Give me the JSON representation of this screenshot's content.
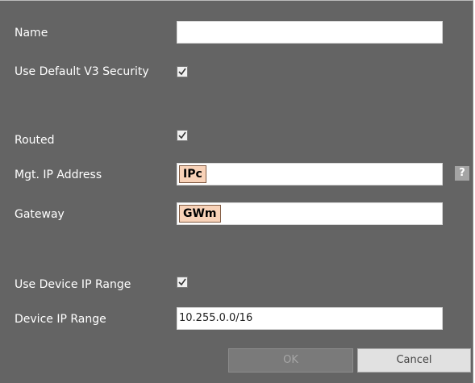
{
  "form": {
    "name_label": "Name",
    "name_value": "",
    "v3_label": "Use Default V3 Security",
    "v3_checked": true,
    "routed_label": "Routed",
    "routed_checked": true,
    "mgt_ip_label": "Mgt. IP Address",
    "mgt_ip_token": "IPc",
    "help_label": "?",
    "gateway_label": "Gateway",
    "gateway_token": "GWm",
    "use_range_label": "Use Device IP Range",
    "use_range_checked": true,
    "range_label": "Device IP Range",
    "range_value": "10.255.0.0/16"
  },
  "buttons": {
    "ok_label": "OK",
    "cancel_label": "Cancel"
  },
  "colors": {
    "background": "#646464",
    "token_fill": "#f8d2b8"
  }
}
